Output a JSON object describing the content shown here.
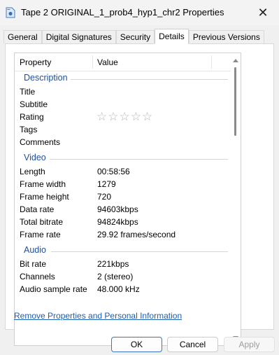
{
  "window": {
    "title": "Tape 2 ORIGINAL_1_prob4_hyp1_chr2 Properties",
    "close_glyph": "✕"
  },
  "tabs": [
    {
      "label": "General"
    },
    {
      "label": "Digital Signatures"
    },
    {
      "label": "Security"
    },
    {
      "label": "Details",
      "active": true
    },
    {
      "label": "Previous Versions"
    }
  ],
  "details": {
    "columns": {
      "property": "Property",
      "value": "Value"
    },
    "groups": {
      "description": {
        "label": "Description",
        "rows": [
          {
            "k": "Title",
            "v": ""
          },
          {
            "k": "Subtitle",
            "v": ""
          },
          {
            "k": "Rating",
            "v": ""
          },
          {
            "k": "Tags",
            "v": ""
          },
          {
            "k": "Comments",
            "v": ""
          }
        ]
      },
      "video": {
        "label": "Video",
        "rows": [
          {
            "k": "Length",
            "v": "00:58:56"
          },
          {
            "k": "Frame width",
            "v": "1279"
          },
          {
            "k": "Frame height",
            "v": "720"
          },
          {
            "k": "Data rate",
            "v": "94603kbps"
          },
          {
            "k": "Total bitrate",
            "v": "94824kbps"
          },
          {
            "k": "Frame rate",
            "v": "29.92 frames/second"
          }
        ]
      },
      "audio": {
        "label": "Audio",
        "rows": [
          {
            "k": "Bit rate",
            "v": "221kbps"
          },
          {
            "k": "Channels",
            "v": "2 (stereo)"
          },
          {
            "k": "Audio sample rate",
            "v": "48.000 kHz"
          }
        ]
      }
    },
    "rating": {
      "stars": 0,
      "max": 5,
      "glyph": "☆"
    }
  },
  "remove_link": "Remove Properties and Personal Information",
  "buttons": {
    "ok": "OK",
    "cancel": "Cancel",
    "apply": "Apply"
  },
  "colors": {
    "accent": "#3b73c7",
    "group_text": "#1f4e9b",
    "link": "#1a5fb4"
  }
}
